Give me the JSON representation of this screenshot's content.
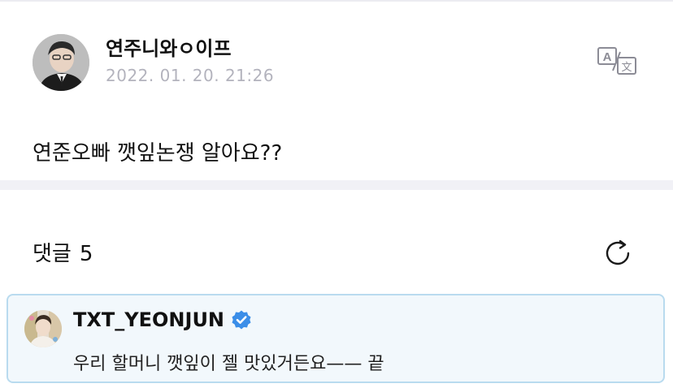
{
  "post": {
    "author": "연주니와ㅇ이프",
    "date": "2022. 01. 20. 21:26",
    "body": "연준오빠 깻잎논쟁 알아요??",
    "avatar_icon": "user-avatar-photo",
    "translate_icon": "translate-icon"
  },
  "comments": {
    "label": "댓글",
    "count": "5",
    "refresh_icon": "refresh-icon"
  },
  "comment": {
    "author": "TXT_YEONJUN",
    "verified_icon": "verified-badge-icon",
    "text": "우리 할머니 깻잎이 젤 맛있거든요—— 끝",
    "highlight_bg": "#f2f8fc",
    "highlight_border": "#b9dbef"
  },
  "colors": {
    "verified_blue": "#3b8ee8",
    "date_gray": "#b3b3bd",
    "divider": "#f1f1f6"
  }
}
